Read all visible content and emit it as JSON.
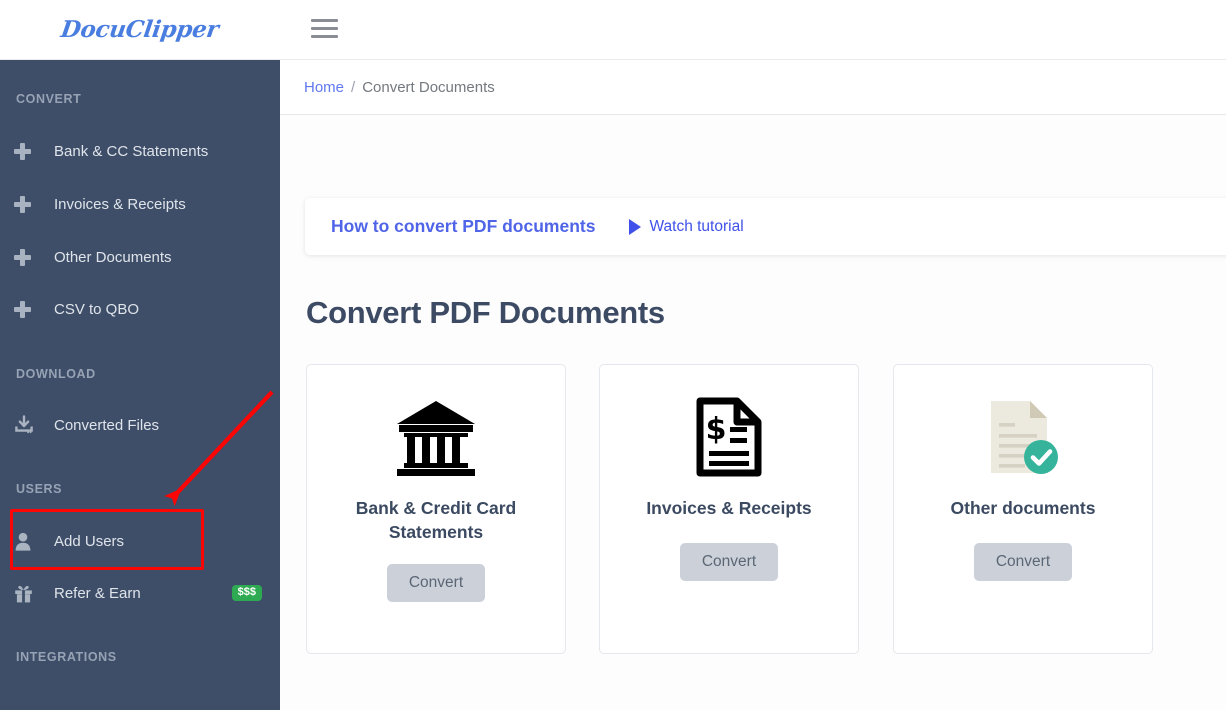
{
  "header": {
    "logo_text": "DocuClipper",
    "menu_icon": "hamburger-menu-icon"
  },
  "sidebar": {
    "sections": [
      {
        "title": "CONVERT",
        "items": [
          {
            "label": "Bank & CC Statements",
            "icon": "plus-icon"
          },
          {
            "label": "Invoices & Receipts",
            "icon": "plus-icon"
          },
          {
            "label": "Other Documents",
            "icon": "plus-icon"
          },
          {
            "label": "CSV to QBO",
            "icon": "plus-icon"
          }
        ]
      },
      {
        "title": "DOWNLOAD",
        "items": [
          {
            "label": "Converted Files",
            "icon": "download-icon"
          }
        ]
      },
      {
        "title": "USERS",
        "items": [
          {
            "label": "Add Users",
            "icon": "user-icon"
          },
          {
            "label": "Refer & Earn",
            "icon": "gift-icon",
            "badge": "$$$"
          }
        ]
      },
      {
        "title": "INTEGRATIONS",
        "items": []
      }
    ]
  },
  "breadcrumb": {
    "home": "Home",
    "separator": "/",
    "current": "Convert Documents"
  },
  "tutorial": {
    "title": "How to convert PDF documents",
    "watch_label": "Watch tutorial",
    "play_icon": "play-triangle-icon"
  },
  "main": {
    "page_title": "Convert PDF Documents",
    "cards": [
      {
        "title": "Bank & Credit Card Statements",
        "button": "Convert",
        "icon": "bank-building-icon"
      },
      {
        "title": "Invoices & Receipts",
        "button": "Convert",
        "icon": "invoice-document-icon"
      },
      {
        "title": "Other documents",
        "button": "Convert",
        "icon": "document-check-icon"
      }
    ]
  },
  "annotation": {
    "highlight_target": "Add Users",
    "color": "#fb0505"
  },
  "colors": {
    "sidebar_bg": "#3e4e68",
    "accent_blue": "#5064e8",
    "logo_blue": "#4a7de0",
    "badge_green": "#2eab52",
    "teal_check": "#35b39b",
    "annotation_red": "#fb0505"
  }
}
